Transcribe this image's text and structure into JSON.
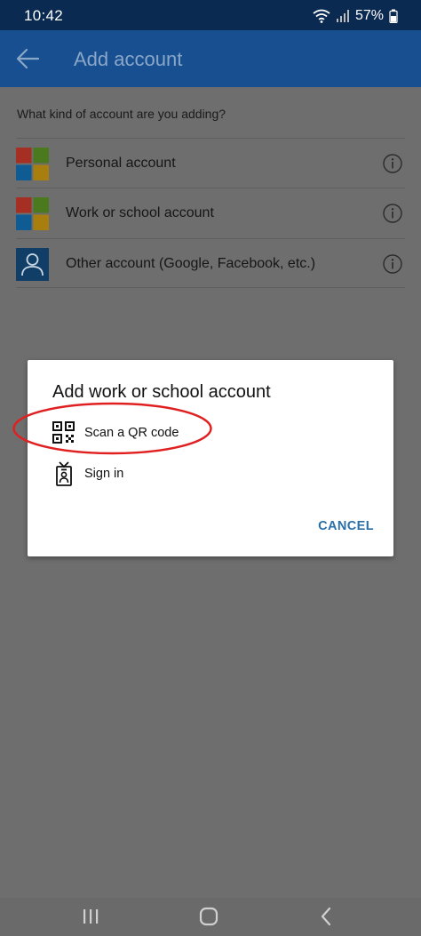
{
  "status_bar": {
    "time": "10:42",
    "battery": "57%",
    "icons": [
      "wifi-icon",
      "signal-icon",
      "battery-icon"
    ]
  },
  "app_bar": {
    "back_icon": "back-arrow-icon",
    "title": "Add account"
  },
  "content": {
    "question": "What kind of account are you adding?",
    "accounts": [
      {
        "label": "Personal account",
        "logo": "microsoft-logo-icon",
        "info_icon": "info-icon"
      },
      {
        "label": "Work or school account",
        "logo": "microsoft-logo-icon",
        "info_icon": "info-icon"
      },
      {
        "label": "Other account (Google, Facebook, etc.)",
        "logo": "person-icon",
        "info_icon": "info-icon"
      }
    ]
  },
  "dialog": {
    "title": "Add work or school account",
    "options": [
      {
        "label": "Scan a QR code",
        "icon": "qr-code-icon"
      },
      {
        "label": "Sign in",
        "icon": "badge-icon"
      }
    ],
    "cancel_label": "CANCEL"
  },
  "nav_bar": {
    "icons": [
      "recent-apps-icon",
      "home-icon",
      "back-icon"
    ]
  },
  "colors": {
    "status_bar_bg": "#0b2a52",
    "app_bar_bg": "#174f91",
    "scrim_bg": "#6e6e6e",
    "dialog_bg": "#ffffff",
    "accent": "#2a6fa8",
    "annotation_red": "#e02020"
  }
}
